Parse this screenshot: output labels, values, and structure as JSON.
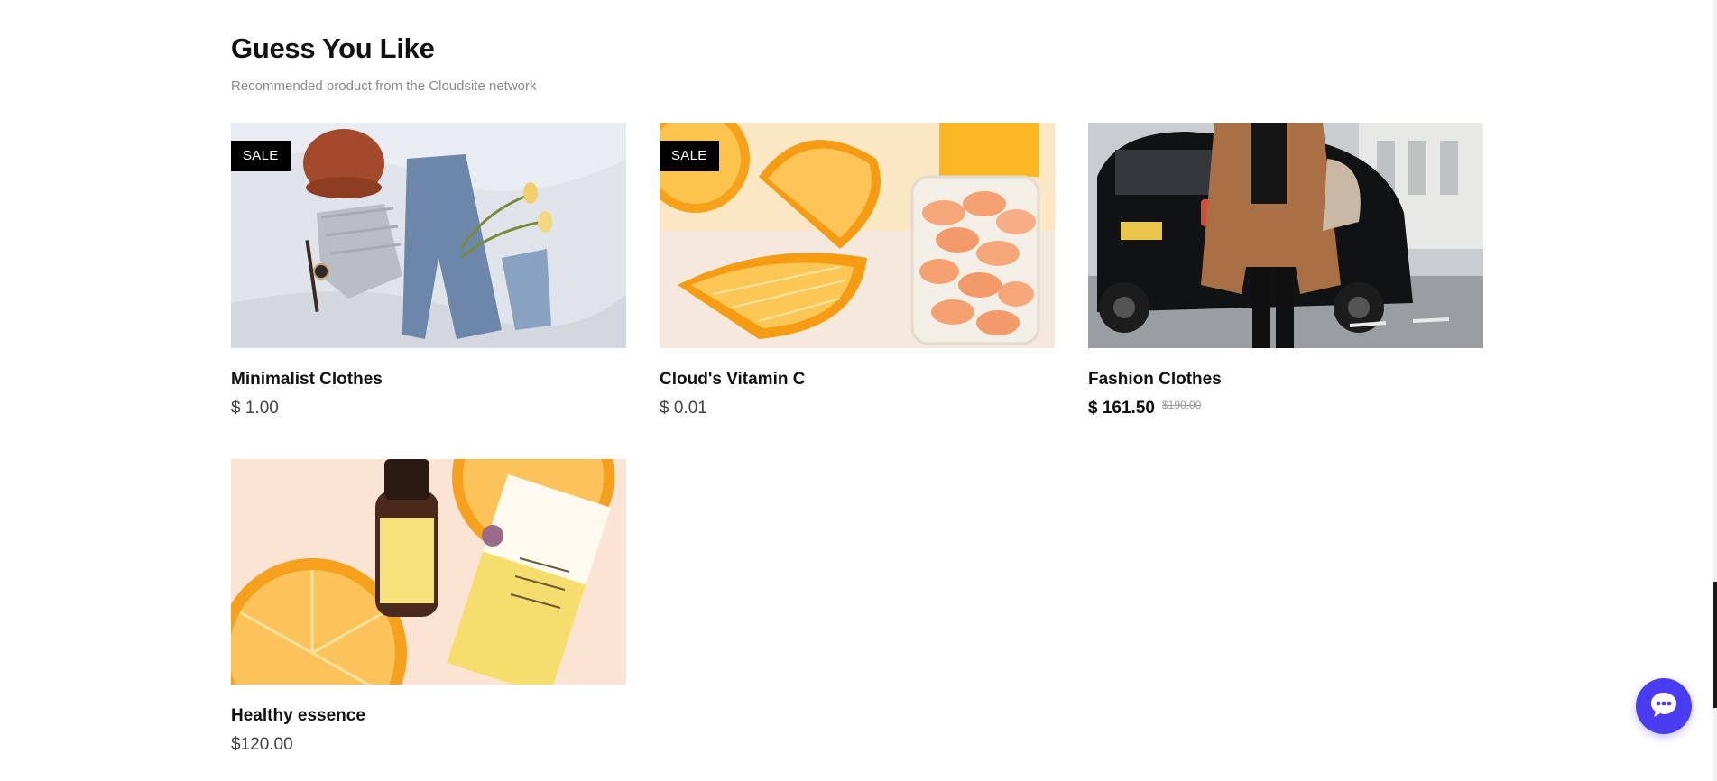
{
  "section": {
    "title": "Guess You Like",
    "subtitle": "Recommended product from the Cloudsite network"
  },
  "products": [
    {
      "name": "Minimalist Clothes",
      "price": "$ 1.00",
      "old_price": "",
      "badge": "SALE",
      "image": "flat-lay of knit beanie, sweater, jeans, watch and tulips"
    },
    {
      "name": "Cloud's Vitamin C",
      "price": "$ 0.01",
      "old_price": "",
      "badge": "SALE",
      "image": "orange slices next to a glass of orange vitamin tablets"
    },
    {
      "name": "Fashion Clothes",
      "price": "$ 161.50",
      "old_price": "$190.00",
      "badge": "",
      "image": "woman in camel coat walking past a black taxi"
    },
    {
      "name": "Healthy essence",
      "price": "$120.00",
      "old_price": "",
      "badge": "",
      "image": "serum bottle and box on orange halves"
    }
  ],
  "chat": {
    "icon": "chat-bubble-icon",
    "color": "#4a3cf0"
  },
  "colors": {
    "badge_bg": "#000000",
    "badge_text": "#ffffff",
    "subtitle": "#8a8a8a"
  }
}
